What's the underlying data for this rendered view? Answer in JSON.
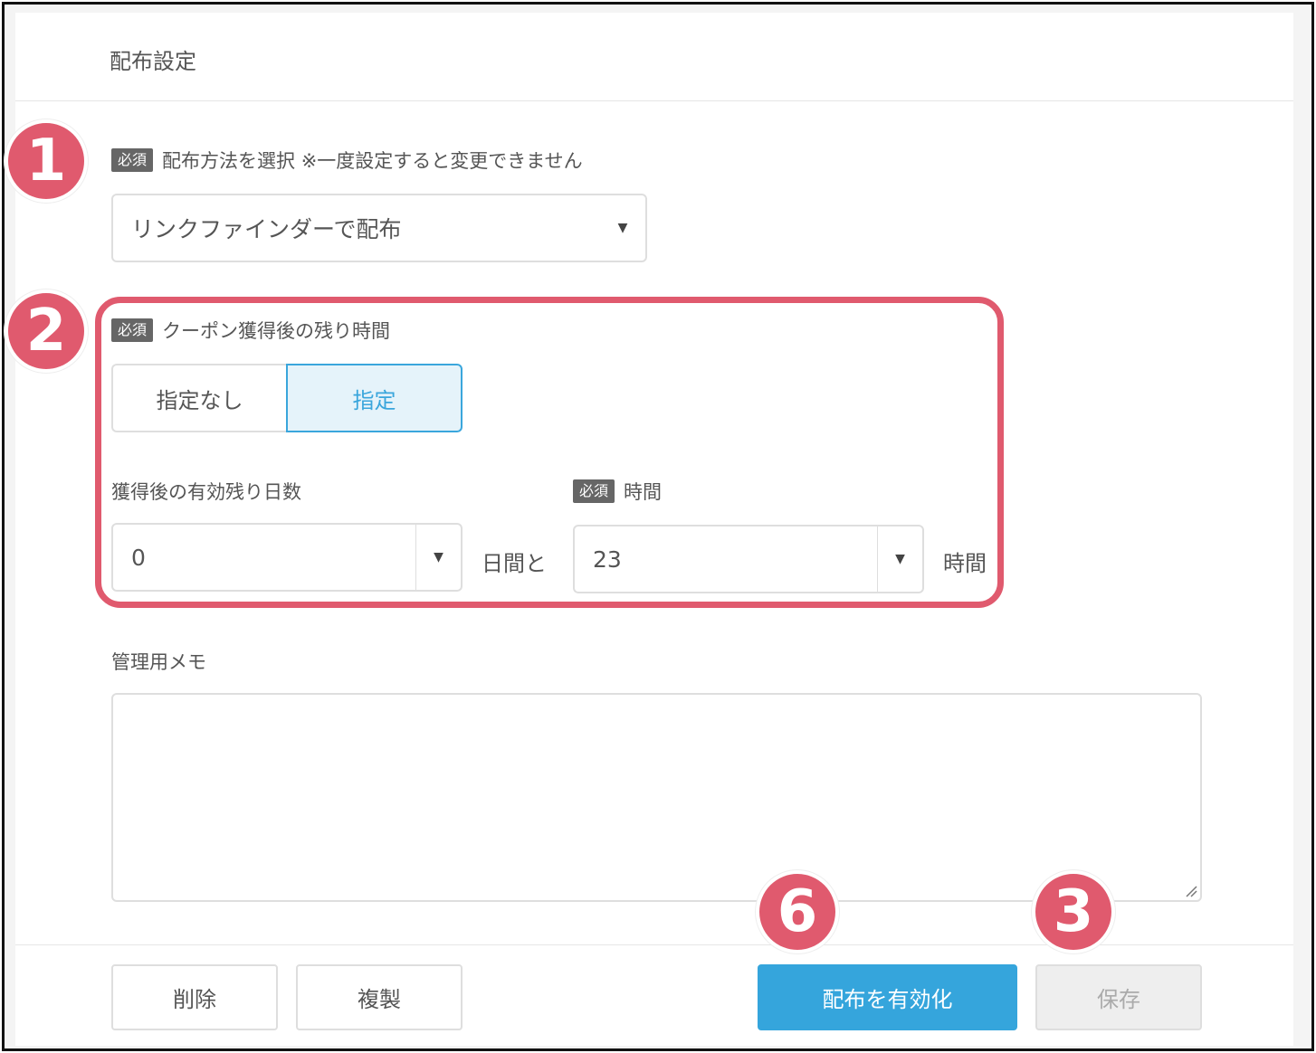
{
  "panel": {
    "title": "配布設定"
  },
  "distribution_method": {
    "badge": "必須",
    "label": "配布方法を選択 ※一度設定すると変更できません",
    "selected": "リンクファインダーで配布"
  },
  "remaining_time": {
    "badge": "必須",
    "label": "クーポン獲得後の残り時間",
    "options": [
      {
        "label": "指定なし",
        "active": false
      },
      {
        "label": "指定",
        "active": true
      }
    ],
    "days_label": "獲得後の有効残り日数",
    "days_value": "0",
    "days_suffix": "日間と",
    "hours_badge": "必須",
    "hours_label": "時間",
    "hours_value": "23",
    "hours_suffix": "時間"
  },
  "memo": {
    "label": "管理用メモ",
    "value": ""
  },
  "footer": {
    "delete_label": "削除",
    "duplicate_label": "複製",
    "activate_label": "配布を有効化",
    "save_label": "保存"
  },
  "markers": [
    "1",
    "2",
    "6",
    "3"
  ],
  "colors": {
    "marker": "#e05a6e",
    "primary": "#35a5dc",
    "active_bg": "#e5f3fa"
  }
}
